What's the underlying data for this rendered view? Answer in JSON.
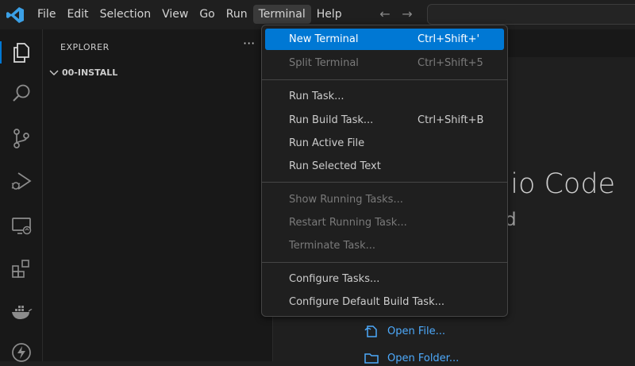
{
  "menubar": {
    "items": [
      "File",
      "Edit",
      "Selection",
      "View",
      "Go",
      "Run",
      "Terminal",
      "Help"
    ],
    "active": "Terminal",
    "back_glyph": "←",
    "forward_glyph": "→"
  },
  "activitybar": {
    "icons": [
      "explorer-icon",
      "search-icon",
      "source-control-icon",
      "run-debug-icon",
      "remote-explorer-icon",
      "extensions-icon",
      "docker-icon",
      "lightning-icon"
    ]
  },
  "sidebar": {
    "title": "EXPLORER",
    "more": "···",
    "folder": "00-INSTALL"
  },
  "welcome": {
    "title_partial": "dio Code",
    "subtitle_partial": "d",
    "links": [
      "Open File...",
      "Open Folder..."
    ]
  },
  "terminal_menu": {
    "groups": [
      [
        {
          "label": "New Terminal",
          "shortcut": "Ctrl+Shift+'",
          "state": "highlighted"
        },
        {
          "label": "Split Terminal",
          "shortcut": "Ctrl+Shift+5",
          "state": "disabled"
        }
      ],
      [
        {
          "label": "Run Task...",
          "shortcut": "",
          "state": "enabled"
        },
        {
          "label": "Run Build Task...",
          "shortcut": "Ctrl+Shift+B",
          "state": "enabled"
        },
        {
          "label": "Run Active File",
          "shortcut": "",
          "state": "enabled"
        },
        {
          "label": "Run Selected Text",
          "shortcut": "",
          "state": "enabled"
        }
      ],
      [
        {
          "label": "Show Running Tasks...",
          "shortcut": "",
          "state": "disabled"
        },
        {
          "label": "Restart Running Task...",
          "shortcut": "",
          "state": "disabled"
        },
        {
          "label": "Terminate Task...",
          "shortcut": "",
          "state": "disabled"
        }
      ],
      [
        {
          "label": "Configure Tasks...",
          "shortcut": "",
          "state": "enabled"
        },
        {
          "label": "Configure Default Build Task...",
          "shortcut": "",
          "state": "enabled"
        }
      ]
    ]
  },
  "colors": {
    "accent": "#0078d4",
    "link": "#4daafc",
    "logo": "#3ba0e6"
  }
}
